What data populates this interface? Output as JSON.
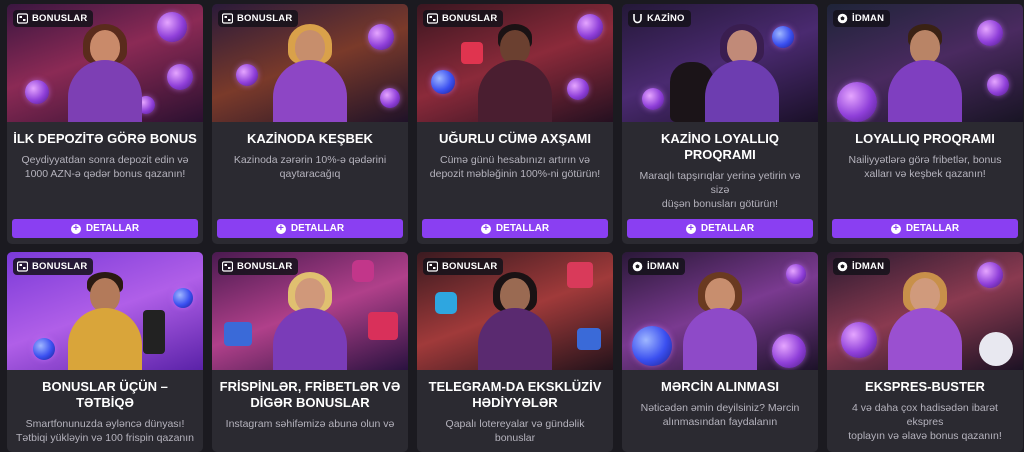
{
  "detail_label": "DETALLAR",
  "colors": {
    "accent": "#8a3ff2",
    "card_bg": "#2b2a31",
    "page_bg": "#1b1a20"
  },
  "cards": [
    {
      "category": "BONUSLAR",
      "category_icon": "bonus-box-icon",
      "title": "İLK DEPOZİTƏ GÖRƏ BONUS",
      "desc_1": "Qeydiyyatdan sonra depozit edin və",
      "desc_2": "1000 AZN-ə qədər bonus qazanın!"
    },
    {
      "category": "BONUSLAR",
      "category_icon": "bonus-box-icon",
      "title": "KAZİNODA KEŞBEK",
      "desc_1": "Kazinoda zərərin 10%-ə qədərini",
      "desc_2": "qaytaracağıq"
    },
    {
      "category": "BONUSLAR",
      "category_icon": "bonus-box-icon",
      "title": "UĞURLU CÜMƏ AXŞAMI",
      "desc_1": "Cümə günü hesabınızı artırın və",
      "desc_2": "depozit məbləğinin 100%-ni götürün!"
    },
    {
      "category": "KAZİNO",
      "category_icon": "horseshoe-icon",
      "title": "KAZİNO LOYALLIQ PROQRAMI",
      "desc_1": "Maraqlı tapşırıqlar yerinə yetirin və sizə",
      "desc_2": "düşən bonusları götürün!"
    },
    {
      "category": "İDMAN",
      "category_icon": "soccer-ball-icon",
      "title": "LOYALLIQ PROQRAMI",
      "desc_1": "Nailiyyətlərə görə fribetlər, bonus",
      "desc_2": "xalları və keşbek qazanın!"
    },
    {
      "category": "BONUSLAR",
      "category_icon": "bonus-box-icon",
      "title_1": "BONUSLAR ÜÇÜN – TƏTBİQƏ",
      "desc_1": "Smartfonunuzda əyləncə dünyası!",
      "desc_2": "Tətbiqi yükləyin və 100 frispin qazanın"
    },
    {
      "category": "BONUSLAR",
      "category_icon": "bonus-box-icon",
      "title_1": "FRİSPİNLƏR, FRİBETLƏR VƏ",
      "title_2": "DİGƏR BONUSLAR",
      "desc_1": "Instagram səhifəmizə abunə olun və"
    },
    {
      "category": "BONUSLAR",
      "category_icon": "bonus-box-icon",
      "title_1": "TELEGRAM-DA EKSKLÜZİV",
      "title_2": "HƏDİYYƏLƏR",
      "desc_1": "Qapalı lotereyalar və gündəlik bonuslar"
    },
    {
      "category": "İDMAN",
      "category_icon": "soccer-ball-icon",
      "title_1": "MƏRCİN ALINMASI",
      "desc_1": "Nəticədən əmin deyilsiniz? Mərcin",
      "desc_2": "alınmasından faydalanın"
    },
    {
      "category": "İDMAN",
      "category_icon": "soccer-ball-icon",
      "title_1": "EKSPRES-BUSTER",
      "desc_1": "4 və daha çox hadisədən ibarət ekspres",
      "desc_2": "toplayın və əlavə bonus qazanın!"
    }
  ]
}
